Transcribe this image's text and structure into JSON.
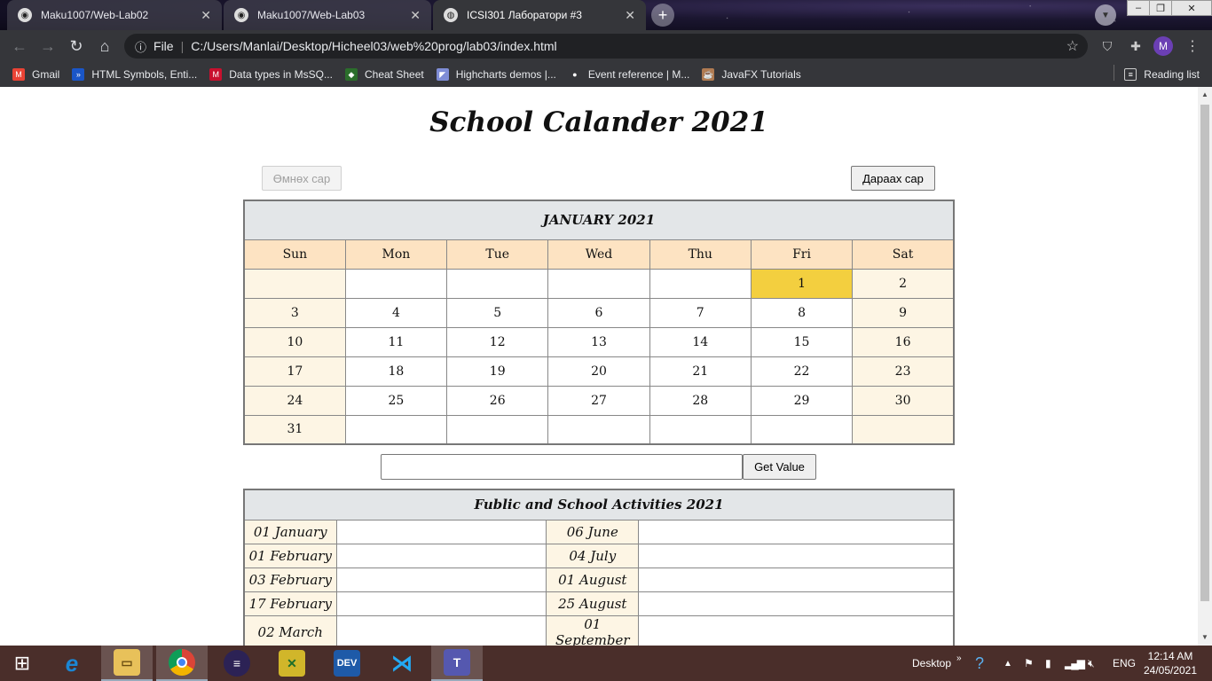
{
  "browser": {
    "tabs": [
      {
        "label": "Maku1007/Web-Lab02",
        "icon": "github-icon"
      },
      {
        "label": "Maku1007/Web-Lab03",
        "icon": "github-icon"
      },
      {
        "label": "ICSI301 Лаборатори #3",
        "icon": "globe-icon"
      }
    ],
    "file_label": "File",
    "url": "C:/Users/Manlai/Desktop/Hicheel03/web%20prog/lab03/index.html",
    "profile_initial": "M",
    "bookmarks": [
      {
        "label": "Gmail",
        "icon": "gmail-icon",
        "color": "#ea4335"
      },
      {
        "label": "HTML Symbols, Enti...",
        "icon": "html-symbols-icon",
        "color": "#1a56c8"
      },
      {
        "label": "Data types in MsSQ...",
        "icon": "mssql-icon",
        "color": "#c8102e"
      },
      {
        "label": "Cheat Sheet",
        "icon": "cheat-sheet-icon",
        "color": "#2b6e2b"
      },
      {
        "label": "Highcharts demos |...",
        "icon": "highcharts-icon",
        "color": "#7f8dd6"
      },
      {
        "label": "Event reference | M...",
        "icon": "mdn-icon",
        "color": "#ffffff"
      },
      {
        "label": "JavaFX Tutorials",
        "icon": "javafx-icon",
        "color": "#b07b52"
      }
    ],
    "reading_list": "Reading list"
  },
  "page": {
    "title": "School Calander 2021",
    "prev_button": "Өмнөх сар",
    "next_button": "Дараах сар",
    "calendar": {
      "month_title": "JANUARY 2021",
      "weekdays": [
        "Sun",
        "Mon",
        "Tue",
        "Wed",
        "Thu",
        "Fri",
        "Sat"
      ],
      "weeks": [
        [
          "",
          "",
          "",
          "",
          "",
          "1",
          "2"
        ],
        [
          "3",
          "4",
          "5",
          "6",
          "7",
          "8",
          "9"
        ],
        [
          "10",
          "11",
          "12",
          "13",
          "14",
          "15",
          "16"
        ],
        [
          "17",
          "18",
          "19",
          "20",
          "21",
          "22",
          "23"
        ],
        [
          "24",
          "25",
          "26",
          "27",
          "28",
          "29",
          "30"
        ],
        [
          "31",
          "",
          "",
          "",
          "",
          "",
          ""
        ]
      ],
      "highlighted_day": "1",
      "highlight_color": "#f3cf3f"
    },
    "value_input": {
      "value": "",
      "placeholder": ""
    },
    "get_value_button": "Get Value",
    "activities": {
      "title": "Fublic and School Activities 2021",
      "rows": [
        [
          "01 January",
          "06 June"
        ],
        [
          "01 February",
          "04 July"
        ],
        [
          "03 February",
          "01 August"
        ],
        [
          "17 February",
          "25 August"
        ],
        [
          "02 March",
          "01 September"
        ]
      ]
    }
  },
  "taskbar": {
    "apps": [
      {
        "name": "edge-legacy-icon",
        "label": "e",
        "color": "#1b86d3"
      },
      {
        "name": "file-explorer-icon",
        "label": "",
        "color": "#e8c15a"
      },
      {
        "name": "chrome-icon",
        "label": "",
        "color": "#4caf50"
      },
      {
        "name": "eclipse-icon",
        "label": "",
        "color": "#2c2255"
      },
      {
        "name": "sql-tool-icon",
        "label": "",
        "color": "#d1b62a"
      },
      {
        "name": "devcpp-icon",
        "label": "DEV",
        "color": "#1e5aa8"
      },
      {
        "name": "vscode-icon",
        "label": "",
        "color": "#23a9f2"
      },
      {
        "name": "teams-icon",
        "label": "T",
        "color": "#5558af"
      }
    ],
    "desktop_label": "Desktop",
    "language": "ENG",
    "time": "12:14 AM",
    "date": "24/05/2021"
  }
}
